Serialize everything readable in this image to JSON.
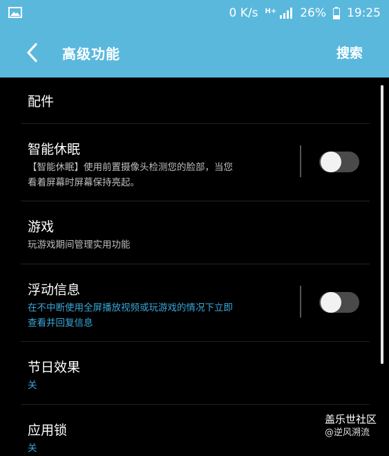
{
  "status_bar": {
    "speed": "0 K/s",
    "network": "H+",
    "battery": "26%",
    "time": "19:25"
  },
  "header": {
    "title": "高级功能",
    "search": "搜索"
  },
  "items": [
    {
      "title": "配件"
    },
    {
      "title": "智能休眠",
      "subtitle_line1": "【智能休眠】使用前置摄像头检测您的脸部，当您",
      "subtitle_line2": "看着屏幕时屏幕保持亮起。",
      "toggle": "off"
    },
    {
      "title": "游戏",
      "subtitle": "玩游戏期间管理实用功能"
    },
    {
      "title": "浮动信息",
      "subtitle_line1": "在不中断使用全屏播放视频或玩游戏的情况下立即",
      "subtitle_line2": "查看并回复信息",
      "toggle": "off"
    },
    {
      "title": "节日效果",
      "subtitle": "关"
    },
    {
      "title": "应用锁",
      "subtitle": "关"
    }
  ],
  "watermark": {
    "brand": "盖乐世社区",
    "author": "@逆风溯流"
  },
  "colors": {
    "accent": "#5ab8dd",
    "link_blue": "#3aa6d9",
    "background": "#000000"
  }
}
